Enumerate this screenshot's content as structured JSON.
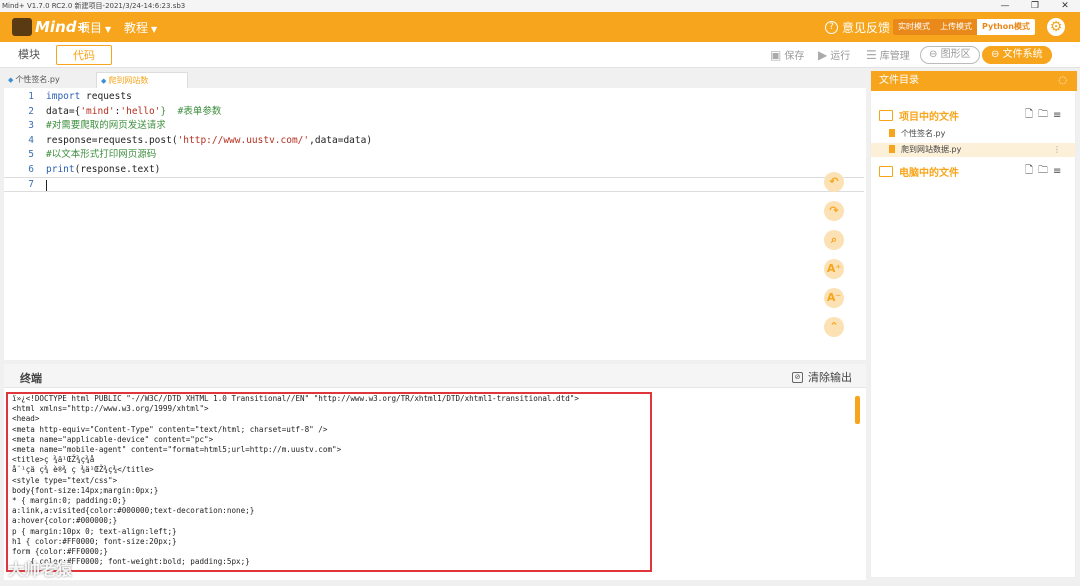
{
  "window": {
    "title": "Mind+ V1.7.0 RC2.0   新建项目-2021/3/24-14:6:23.sb3",
    "minimize": "—",
    "maximize": "❐",
    "close": "✕"
  },
  "menubar": {
    "logo": "Mind+",
    "project_menu": "项目",
    "tutorial_menu": "教程",
    "feedback": "意见反馈",
    "modes": [
      "实时模式",
      "上传模式",
      "Python模式"
    ],
    "active_mode": "Python模式",
    "settings_icon": "gear-icon"
  },
  "toolbar": {
    "block_tab": "模块",
    "code_tab": "代码",
    "save": "保存",
    "run": "运行",
    "library": "库管理",
    "graph_area": "图形区",
    "file_system": "文件系统"
  },
  "file_tabs": [
    {
      "label": "个性签名.py"
    },
    {
      "label": "爬到网站数据.py",
      "close": "×"
    }
  ],
  "editor": {
    "line_numbers": [
      "1",
      "2",
      "3",
      "4",
      "5",
      "6",
      "7"
    ],
    "lines": [
      {
        "a": "import",
        "b": " requests"
      },
      {
        "a": "data={",
        "s1": "'mind'",
        "m": ":",
        "s2": "'hello'",
        "c": "}  #表单参数"
      },
      {
        "cmt": "#对需要爬取的网页发送请求"
      },
      {
        "a": "response=requests.post(",
        "s1": "'http://www.uustv.com/'",
        "c": ",data=data)"
      },
      {
        "cmt": "#以文本形式打印网页源码"
      },
      {
        "a": "print",
        "b": "(response.text)"
      }
    ]
  },
  "terminal": {
    "title": "终端",
    "clear_label": "清除输出",
    "output": [
      "ï»¿<!DOCTYPE html PUBLIC \"-//W3C//DTD XHTML 1.0 Transitional//EN\" \"http://www.w3.org/TR/xhtml1/DTD/xhtml1-transitional.dtd\">",
      "<html xmlns=\"http://www.w3.org/1999/xhtml\">",
      "<head>",
      "<meta http-equiv=\"Content-Type\" content=\"text/html; charset=utf-8\" />",
      "<meta name=\"applicable-device\" content=\"pc\">",
      "<meta name=\"mobile-agent\" content=\"format=html5;url=http://m.uustv.com\">",
      "<title>ç ¾ä¹ŒŽ¾ç­¾å",
      "å¨¹çä ç­¾ è®¾ ç ¾ä¹ŒŽ¾ç­¾</title>",
      "<style type=\"text/css\">",
      "body{font-size:14px;margin:0px;}",
      "* { margin:0; padding:0;}",
      "a:link,a:visited{color:#000000;text-decoration:none;}",
      "a:hover{color:#000000;}",
      "p { margin:10px 0; text-align:left;}",
      "h1 { color:#FF0000; font-size:20px;}",
      "form {color:#FF0000;}",
      "    { color:#FF0000; font-weight:bold; padding:5px;}"
    ]
  },
  "file_panel": {
    "title": "文件目录",
    "project_files_label": "项目中的文件",
    "project_files": [
      "个性签名.py",
      "爬到网站数据.py"
    ],
    "selected_file": "爬到网站数据.py",
    "computer_files_label": "电脑中的文件"
  },
  "watermark": "大帅老猿"
}
